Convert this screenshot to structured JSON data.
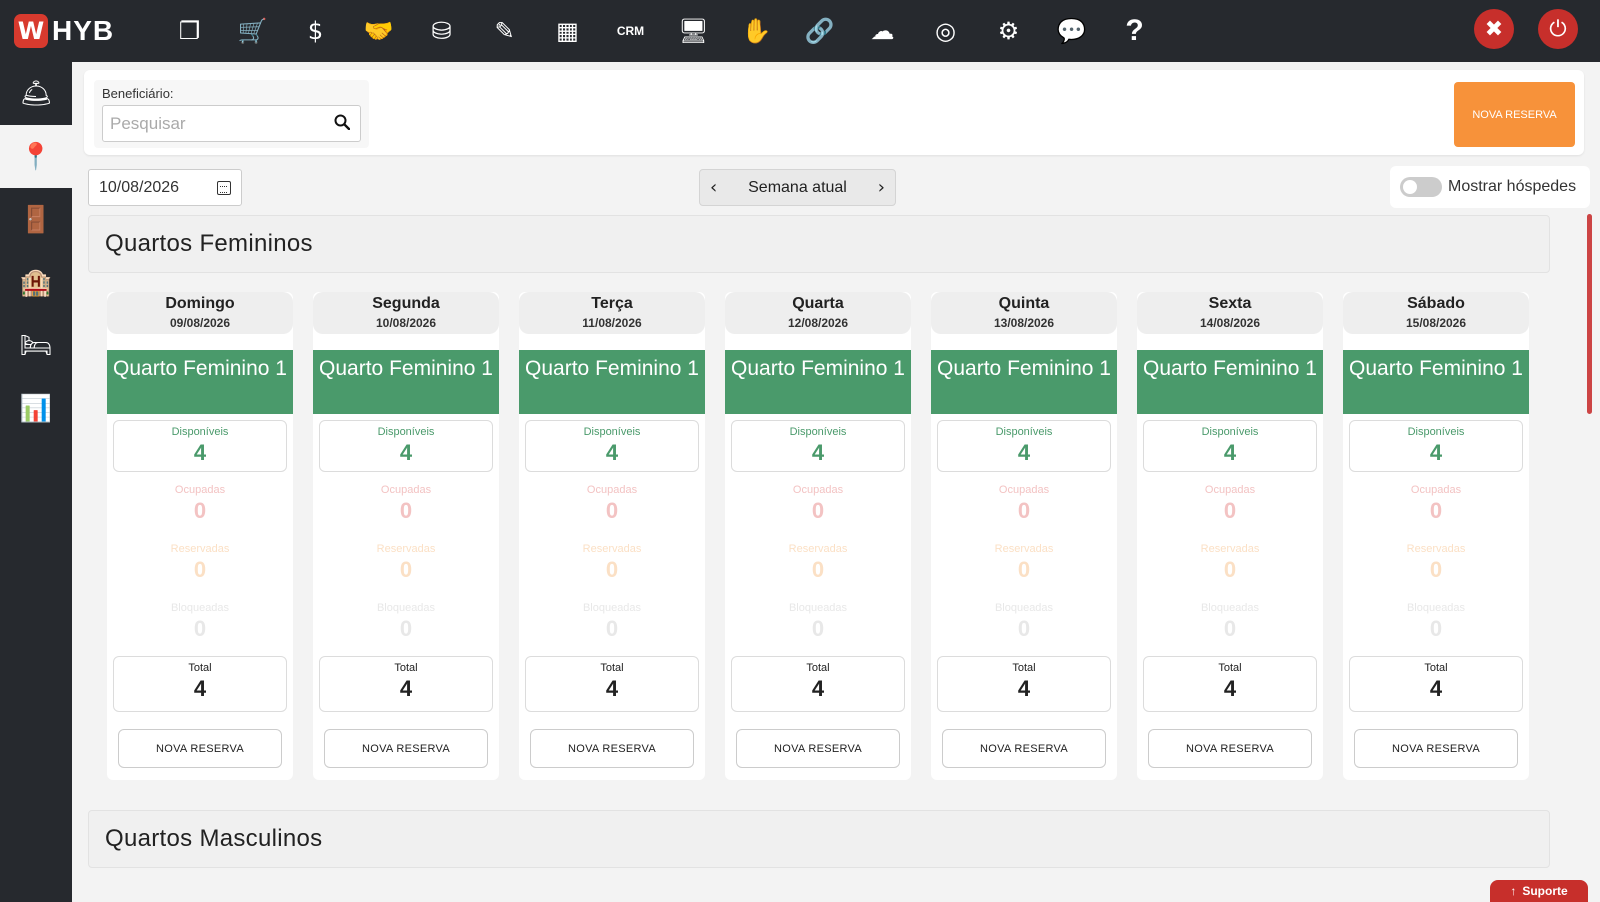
{
  "app": {
    "logo_mark": "W",
    "logo_text": "HYB"
  },
  "topnav": [
    {
      "icon": "copy-icon",
      "glyph": "❐"
    },
    {
      "icon": "cart-icon",
      "glyph": "🛒"
    },
    {
      "icon": "dollar-icon",
      "glyph": "$"
    },
    {
      "icon": "handshake-icon",
      "glyph": "🤝"
    },
    {
      "icon": "coins-icon",
      "glyph": "⛁"
    },
    {
      "icon": "pencil-icon",
      "glyph": "✎"
    },
    {
      "icon": "calculator-icon",
      "glyph": "▦"
    },
    {
      "icon": "crm-icon",
      "glyph": "CRM"
    },
    {
      "icon": "monitor-icon",
      "glyph": "🖥"
    },
    {
      "icon": "hands-icon",
      "glyph": "✋"
    },
    {
      "icon": "link-icon",
      "glyph": "🔗"
    },
    {
      "icon": "cloud-upload-icon",
      "glyph": "☁"
    },
    {
      "icon": "target-icon",
      "glyph": "◎"
    },
    {
      "icon": "gears-icon",
      "glyph": "⚙"
    },
    {
      "icon": "chat-icon",
      "glyph": "💬"
    },
    {
      "icon": "help-icon",
      "glyph": "?"
    }
  ],
  "top_right": [
    {
      "icon": "tools-icon",
      "glyph": "✖"
    },
    {
      "icon": "power-icon",
      "glyph": "⏻"
    }
  ],
  "sidebar": [
    {
      "icon": "reception-bell-icon",
      "glyph": "🛎",
      "active": false
    },
    {
      "icon": "map-pin-icon",
      "glyph": "📍",
      "active": true
    },
    {
      "icon": "door-hanger-icon",
      "glyph": "🚪",
      "active": false
    },
    {
      "icon": "hotel-icon",
      "glyph": "🏨",
      "active": false
    },
    {
      "icon": "beds-icon",
      "glyph": "🛏",
      "active": false
    },
    {
      "icon": "report-icon",
      "glyph": "📊",
      "active": false
    }
  ],
  "filter": {
    "beneficiario_label": "Beneficiário:",
    "search_placeholder": "Pesquisar",
    "nova_reserva_label": "NOVA RESERVA"
  },
  "date_value": "10/08/2026",
  "week_nav": {
    "label": "Semana atual",
    "prev": "‹",
    "next": "›"
  },
  "toggle": {
    "label": "Mostrar hóspedes",
    "on": false
  },
  "sections": {
    "feminino_title": "Quartos Femininos",
    "masculino_title": "Quartos Masculinos"
  },
  "stat_labels": {
    "disponiveis": "Disponíveis",
    "ocupadas": "Ocupadas",
    "reservadas": "Reservadas",
    "bloqueadas": "Bloqueadas",
    "total": "Total"
  },
  "days": [
    {
      "name": "Domingo",
      "date": "09/08/2026",
      "room": "Quarto Feminino 1",
      "disponiveis": "4",
      "ocupadas": "0",
      "reservadas": "0",
      "bloqueadas": "0",
      "total": "4",
      "button": "NOVA RESERVA"
    },
    {
      "name": "Segunda",
      "date": "10/08/2026",
      "room": "Quarto Feminino 1",
      "disponiveis": "4",
      "ocupadas": "0",
      "reservadas": "0",
      "bloqueadas": "0",
      "total": "4",
      "button": "NOVA RESERVA"
    },
    {
      "name": "Terça",
      "date": "11/08/2026",
      "room": "Quarto Feminino 1",
      "disponiveis": "4",
      "ocupadas": "0",
      "reservadas": "0",
      "bloqueadas": "0",
      "total": "4",
      "button": "NOVA RESERVA"
    },
    {
      "name": "Quarta",
      "date": "12/08/2026",
      "room": "Quarto Feminino 1",
      "disponiveis": "4",
      "ocupadas": "0",
      "reservadas": "0",
      "bloqueadas": "0",
      "total": "4",
      "button": "NOVA RESERVA"
    },
    {
      "name": "Quinta",
      "date": "13/08/2026",
      "room": "Quarto Feminino 1",
      "disponiveis": "4",
      "ocupadas": "0",
      "reservadas": "0",
      "bloqueadas": "0",
      "total": "4",
      "button": "NOVA RESERVA"
    },
    {
      "name": "Sexta",
      "date": "14/08/2026",
      "room": "Quarto Feminino 1",
      "disponiveis": "4",
      "ocupadas": "0",
      "reservadas": "0",
      "bloqueadas": "0",
      "total": "4",
      "button": "NOVA RESERVA"
    },
    {
      "name": "Sábado",
      "date": "15/08/2026",
      "room": "Quarto Feminino 1",
      "disponiveis": "4",
      "ocupadas": "0",
      "reservadas": "0",
      "bloqueadas": "0",
      "total": "4",
      "button": "NOVA RESERVA"
    }
  ],
  "suporte": {
    "label": "Suporte",
    "glyph": "↑"
  },
  "colors": {
    "topbar": "#26292e",
    "accent_orange": "#f7923a",
    "room_green": "#4a9a6b",
    "danger_red": "#c72f2b"
  }
}
